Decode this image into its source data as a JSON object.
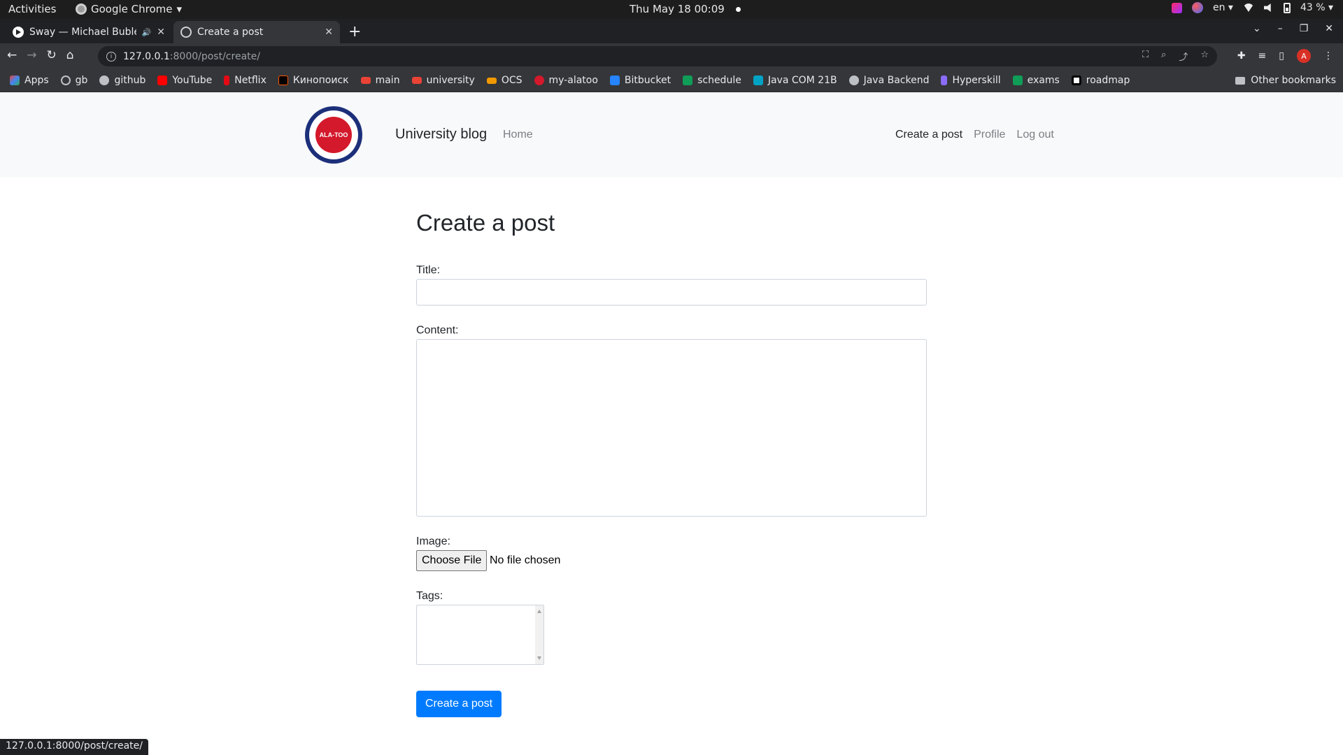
{
  "system_bar": {
    "activities": "Activities",
    "app_name": "Google Chrome",
    "clock": "Thu May 18  00:09",
    "lang": "en",
    "battery": "43 %"
  },
  "browser": {
    "tabs": [
      {
        "title": "Sway — Michael Bublé"
      },
      {
        "title": "Create a post"
      }
    ],
    "url_host": "127.0.0.1",
    "url_path": ":8000/post/create/",
    "bookmarks": [
      {
        "label": "Apps",
        "color": "#f4b400"
      },
      {
        "label": "gb",
        "color": "#bdc1c6"
      },
      {
        "label": "github",
        "color": "#bdc1c6"
      },
      {
        "label": "YouTube",
        "color": "#ff0000"
      },
      {
        "label": "Netflix",
        "color": "#e50914"
      },
      {
        "label": "Кинопоиск",
        "color": "#ff5500"
      },
      {
        "label": "main",
        "color": "#ea4335"
      },
      {
        "label": "university",
        "color": "#ea4335"
      },
      {
        "label": "OCS",
        "color": "#f29900"
      },
      {
        "label": "my-alatoo",
        "color": "#d3192b"
      },
      {
        "label": "Bitbucket",
        "color": "#2684ff"
      },
      {
        "label": "schedule",
        "color": "#0f9d58"
      },
      {
        "label": "Java COM 21B",
        "color": "#00a3c4"
      },
      {
        "label": "Java Backend",
        "color": "#bdc1c6"
      },
      {
        "label": "Hyperskill",
        "color": "#8c6cff"
      },
      {
        "label": "exams",
        "color": "#0f9d58"
      },
      {
        "label": "roadmap",
        "color": "#ffffff"
      }
    ],
    "other_bookmarks": "Other bookmarks",
    "status_url": "127.0.0.1:8000/post/create/"
  },
  "site": {
    "logo_text": "ALA-TOO",
    "brand": "University blog",
    "nav_home": "Home",
    "nav_create": "Create a post",
    "nav_profile": "Profile",
    "nav_logout": "Log out"
  },
  "form": {
    "heading": "Create a post",
    "title_label": "Title:",
    "title_value": "",
    "content_label": "Content:",
    "content_value": "",
    "image_label": "Image:",
    "file_button": "Choose File",
    "file_status": "No file chosen",
    "tags_label": "Tags:",
    "submit_label": "Create a post"
  },
  "colors": {
    "primary": "#007bff",
    "navbar_bg": "#f8f9fa"
  }
}
